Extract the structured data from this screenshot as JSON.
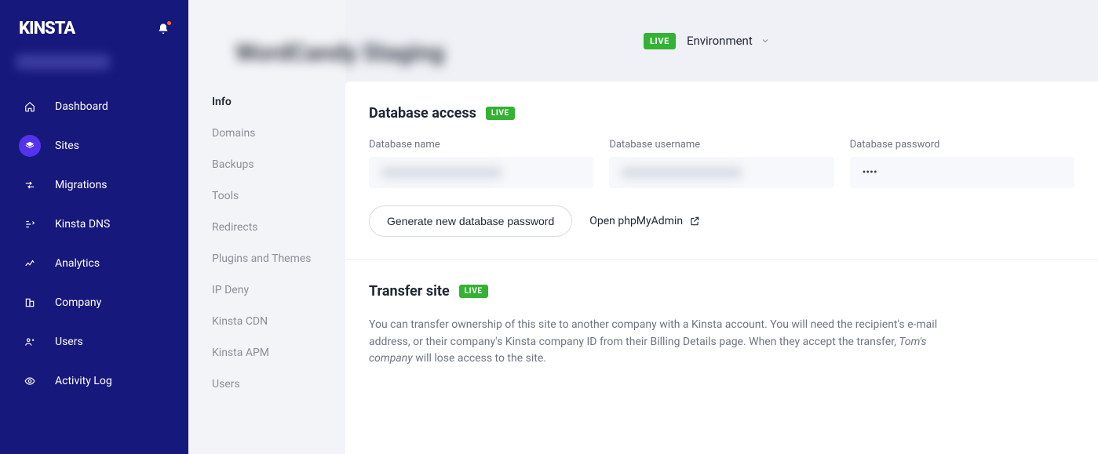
{
  "brand": "KINSTA",
  "nav": {
    "items": [
      {
        "label": "Dashboard"
      },
      {
        "label": "Sites"
      },
      {
        "label": "Migrations"
      },
      {
        "label": "Kinsta DNS"
      },
      {
        "label": "Analytics"
      },
      {
        "label": "Company"
      },
      {
        "label": "Users"
      },
      {
        "label": "Activity Log"
      }
    ]
  },
  "site_title_placeholder": "WordCandy Staging",
  "subnav": {
    "items": [
      {
        "label": "Info"
      },
      {
        "label": "Domains"
      },
      {
        "label": "Backups"
      },
      {
        "label": "Tools"
      },
      {
        "label": "Redirects"
      },
      {
        "label": "Plugins and Themes"
      },
      {
        "label": "IP Deny"
      },
      {
        "label": "Kinsta CDN"
      },
      {
        "label": "Kinsta APM"
      },
      {
        "label": "Users"
      }
    ]
  },
  "env": {
    "badge": "LIVE",
    "label": "Environment"
  },
  "db": {
    "title": "Database access",
    "badge": "LIVE",
    "name_label": "Database name",
    "user_label": "Database username",
    "pass_label": "Database password",
    "pass_value": "••••",
    "btn_generate": "Generate new database password",
    "link_pma": "Open phpMyAdmin"
  },
  "transfer": {
    "title": "Transfer site",
    "badge": "LIVE",
    "desc_pre": "You can transfer ownership of this site to another company with a Kinsta account. You will need the recipient's e-mail address, or their company's Kinsta company ID from their Billing Details page. When they accept the transfer, ",
    "company": "Tom's company",
    "desc_post": " will lose access to the site."
  }
}
